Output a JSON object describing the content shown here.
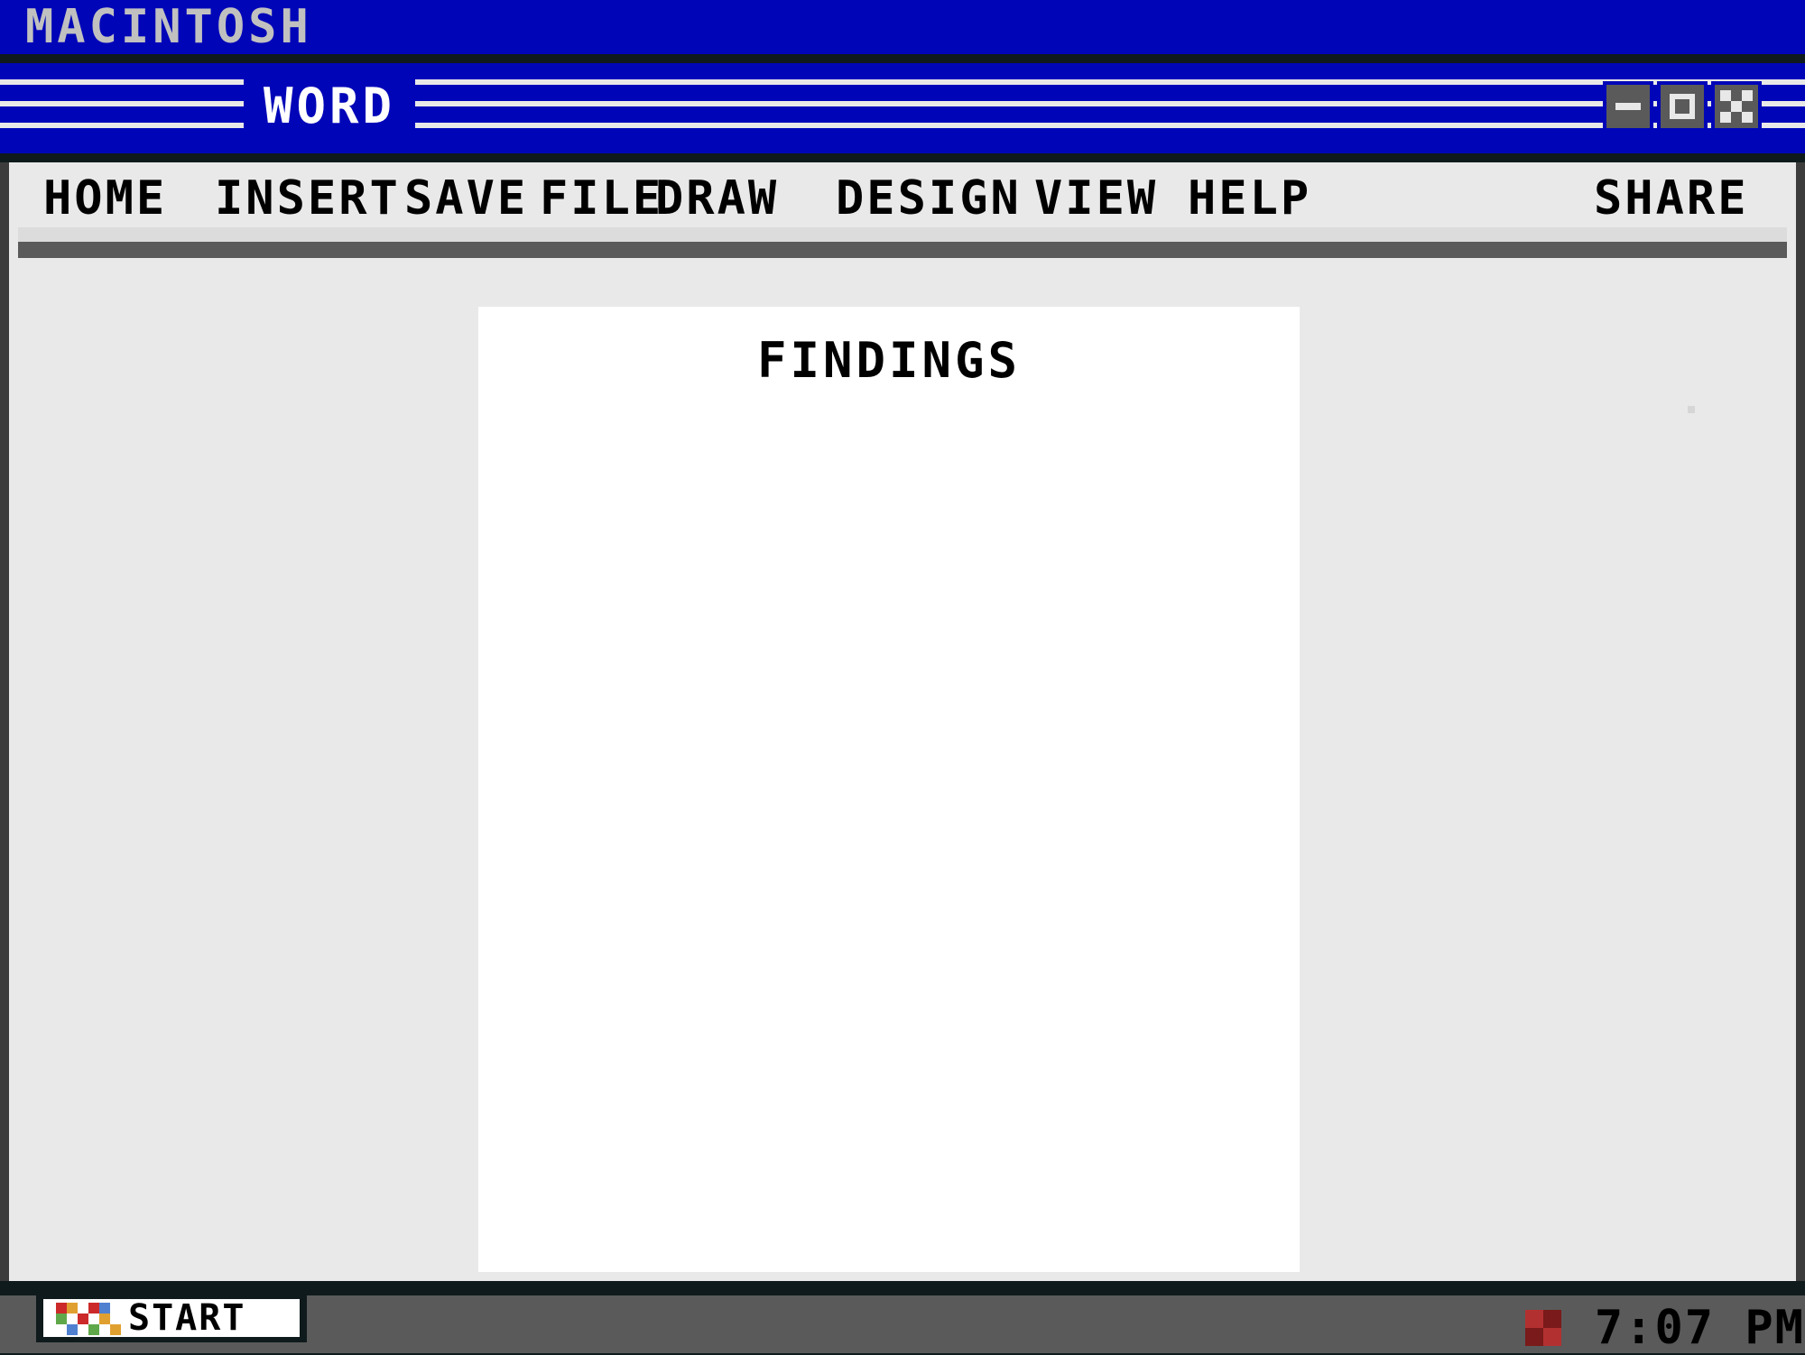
{
  "os": {
    "title": "MACINTOSH"
  },
  "window": {
    "title": "WORD",
    "controls": {
      "minimize_icon": "minimize-icon",
      "maximize_icon": "maximize-icon",
      "close_icon": "close-icon"
    }
  },
  "menu": {
    "items": [
      "HOME",
      "INSERT",
      "SAVE",
      "FILE",
      "DRAW",
      "DESIGN",
      "VIEW",
      "HELP"
    ],
    "share": "SHARE"
  },
  "document": {
    "heading": "FINDINGS"
  },
  "taskbar": {
    "start_label": "START",
    "clock": "7:07 PM"
  },
  "colors": {
    "title_blue": "#0006b8",
    "window_bg": "#e9e9e9",
    "taskbar_gray": "#5a5a5a",
    "page_white": "#ffffff"
  }
}
